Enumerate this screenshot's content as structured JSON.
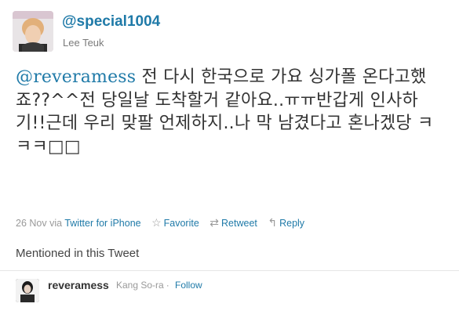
{
  "tweet": {
    "author_handle": "@special1004",
    "author_name": "Lee Teuk",
    "mention": "@reveramess",
    "body": " 전 다시 한국으로 가요 싱가폴 온다고했죠??^^전 당일날 도착할거 같아요..ㅠㅠ반갑게 인사하기!!근데 우리 맞팔 언제하지..나 막 남겼다고 혼나겠당 ㅋㅋㅋ□□",
    "date": "26 Nov",
    "via_prefix": "via",
    "source": "Twitter for iPhone",
    "actions": {
      "favorite": "Favorite",
      "retweet": "Retweet",
      "reply": "Reply"
    }
  },
  "mentioned": {
    "title": "Mentioned in this Tweet",
    "user": {
      "handle": "reveramess",
      "name": "Kang So-ra",
      "separator": "·",
      "follow": "Follow"
    }
  },
  "icons": {
    "favorite": "star-icon",
    "retweet": "retweet-icon",
    "reply": "reply-arrow-icon"
  },
  "colors": {
    "link": "#1f7aa8",
    "muted": "#999999",
    "text": "#333333"
  }
}
